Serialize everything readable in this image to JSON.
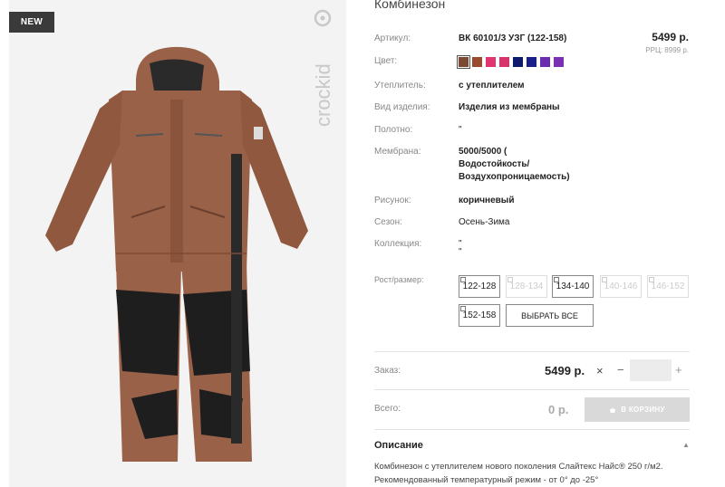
{
  "badge": {
    "new": "NEW"
  },
  "brand": {
    "logo_text": "crockid"
  },
  "product": {
    "title": "Комбинезон",
    "price": "5499 р.",
    "rrp": "РРЦ: 8999 р."
  },
  "attributes": {
    "article": {
      "label": "Артикул:",
      "value": "ВК 60101/3 УЗГ (122-158)"
    },
    "color": {
      "label": "Цвет:"
    },
    "insulation": {
      "label": "Утеплитель:",
      "value": "с утеплителем"
    },
    "type": {
      "label": "Вид изделия:",
      "value": "Изделия из мембраны"
    },
    "fabric": {
      "label": "Полотно:",
      "value": "\""
    },
    "membrane": {
      "label": "Мембрана:",
      "line1": "5000/5000 (",
      "line2": "Водостойкость/",
      "line3": "Воздухопроницаемость)"
    },
    "pattern": {
      "label": "Рисунок:",
      "value": "коричневый"
    },
    "season": {
      "label": "Сезон:",
      "value": "Осень-Зима"
    },
    "collection": {
      "label": "Коллекция:",
      "line1": "\"",
      "line2": "\""
    },
    "sizes": {
      "label": "Рост/размер:"
    }
  },
  "swatches": [
    {
      "color": "#7b4a33",
      "selected": true
    },
    {
      "color": "#9a4a2e"
    },
    {
      "color": "#e0356f"
    },
    {
      "color": "#d9336b"
    },
    {
      "color": "#0e1a6e"
    },
    {
      "color": "#1b1f8a"
    },
    {
      "color": "#6b2db0"
    },
    {
      "color": "#7a2fb5"
    }
  ],
  "sizes": [
    {
      "label": "122-128",
      "available": true
    },
    {
      "label": "128-134",
      "available": false
    },
    {
      "label": "134-140",
      "available": true
    },
    {
      "label": "140-146",
      "available": false
    },
    {
      "label": "146-152",
      "available": false
    },
    {
      "label": "152-158",
      "available": true
    }
  ],
  "select_all_label": "ВЫБРАТЬ ВСЕ",
  "order": {
    "label": "Заказ:",
    "price": "5499 р.",
    "remove": "×",
    "minus": "−",
    "plus": "+",
    "quantity": ""
  },
  "total": {
    "label": "Всего:",
    "price": "0 р.",
    "cart_label": "В КОРЗИНУ"
  },
  "description": {
    "title": "Описание",
    "text": "Комбинезон с утеплителем нового поколения Слайтекс Найс® 250 г/м2. Рекомендованный температурный режим - от 0° до -25°"
  },
  "colors": {
    "suit_brown": "#9a6149",
    "suit_shadow": "#7c4a35",
    "knee_black": "#1e1e1e",
    "badge_bg": "#3a3a3a"
  }
}
